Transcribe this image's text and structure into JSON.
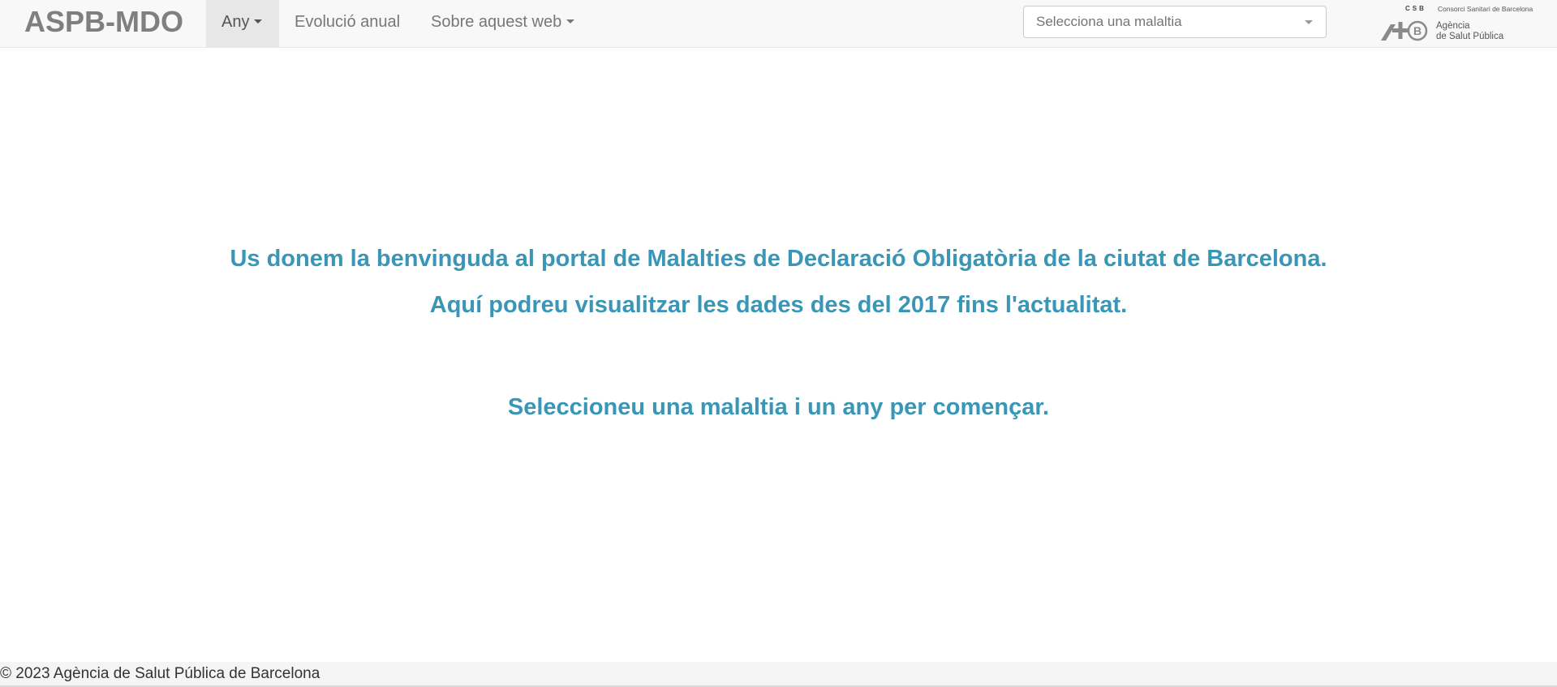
{
  "navbar": {
    "brand": "ASPB-MDO",
    "items": [
      {
        "label": "Any",
        "dropdown": true,
        "active": true
      },
      {
        "label": "Evolució anual",
        "dropdown": false,
        "active": false
      },
      {
        "label": "Sobre aquest web",
        "dropdown": true,
        "active": false
      }
    ],
    "disease_select": {
      "placeholder": "Selecciona una malaltia"
    },
    "logo": {
      "csb": "CSB",
      "consorci": "Consorci Sanitari de Barcelona",
      "agencia_line1": "Agència",
      "agencia_line2": "de Salut Pública"
    }
  },
  "main": {
    "welcome_line1": "Us donem la benvinguda al portal de Malalties de Declaració Obligatòria de la ciutat de Barcelona.",
    "welcome_line2": "Aquí podreu visualitzar les dades des del 2017 fins l'actualitat.",
    "instruction": "Seleccioneu una malaltia i un any per començar."
  },
  "footer": {
    "copyright": "© 2023 Agència de Salut Pública de Barcelona"
  },
  "colors": {
    "accent": "#3a96b6",
    "navbar_bg": "#f8f8f8",
    "active_tab_bg": "#e7e7e7"
  }
}
